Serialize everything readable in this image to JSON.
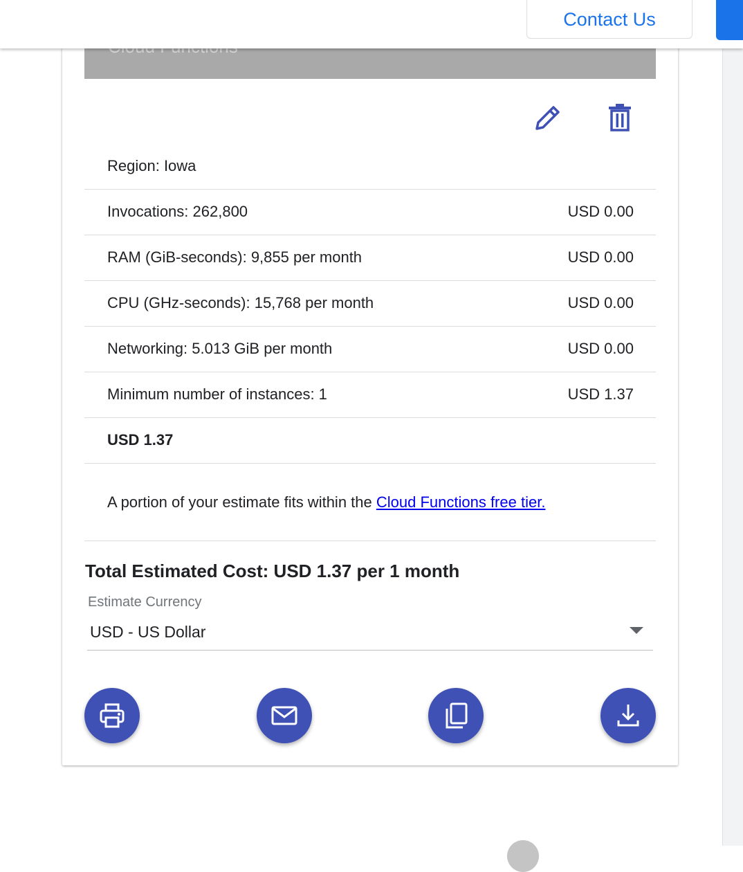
{
  "header": {
    "contact_label": "Contact Us"
  },
  "estimate": {
    "service_title": "Cloud Functions",
    "region": "Region: Iowa",
    "items": [
      {
        "label": "Invocations: 262,800",
        "cost": "USD 0.00"
      },
      {
        "label": "RAM (GiB-seconds): 9,855 per month",
        "cost": "USD 0.00"
      },
      {
        "label": "CPU (GHz-seconds): 15,768 per month",
        "cost": "USD 0.00"
      },
      {
        "label": "Networking: 5.013 GiB per month",
        "cost": "USD 0.00"
      },
      {
        "label": "Minimum number of instances: 1",
        "cost": "USD 1.37"
      }
    ],
    "subtotal": "USD 1.37",
    "note_prefix": "A portion of your estimate fits within the ",
    "note_link": "Cloud Functions free tier."
  },
  "summary": {
    "total_cost": "Total Estimated Cost: USD 1.37 per 1 month",
    "currency_label": "Estimate Currency",
    "currency_value": "USD - US Dollar"
  },
  "actions": {
    "icons": [
      "pencil-icon",
      "trash-icon",
      "print-icon",
      "email-icon",
      "copy-icon",
      "download-icon"
    ]
  },
  "colors": {
    "accent": "#3f51b5",
    "brand_blue": "#1a73e8",
    "link": "#0000ee"
  }
}
